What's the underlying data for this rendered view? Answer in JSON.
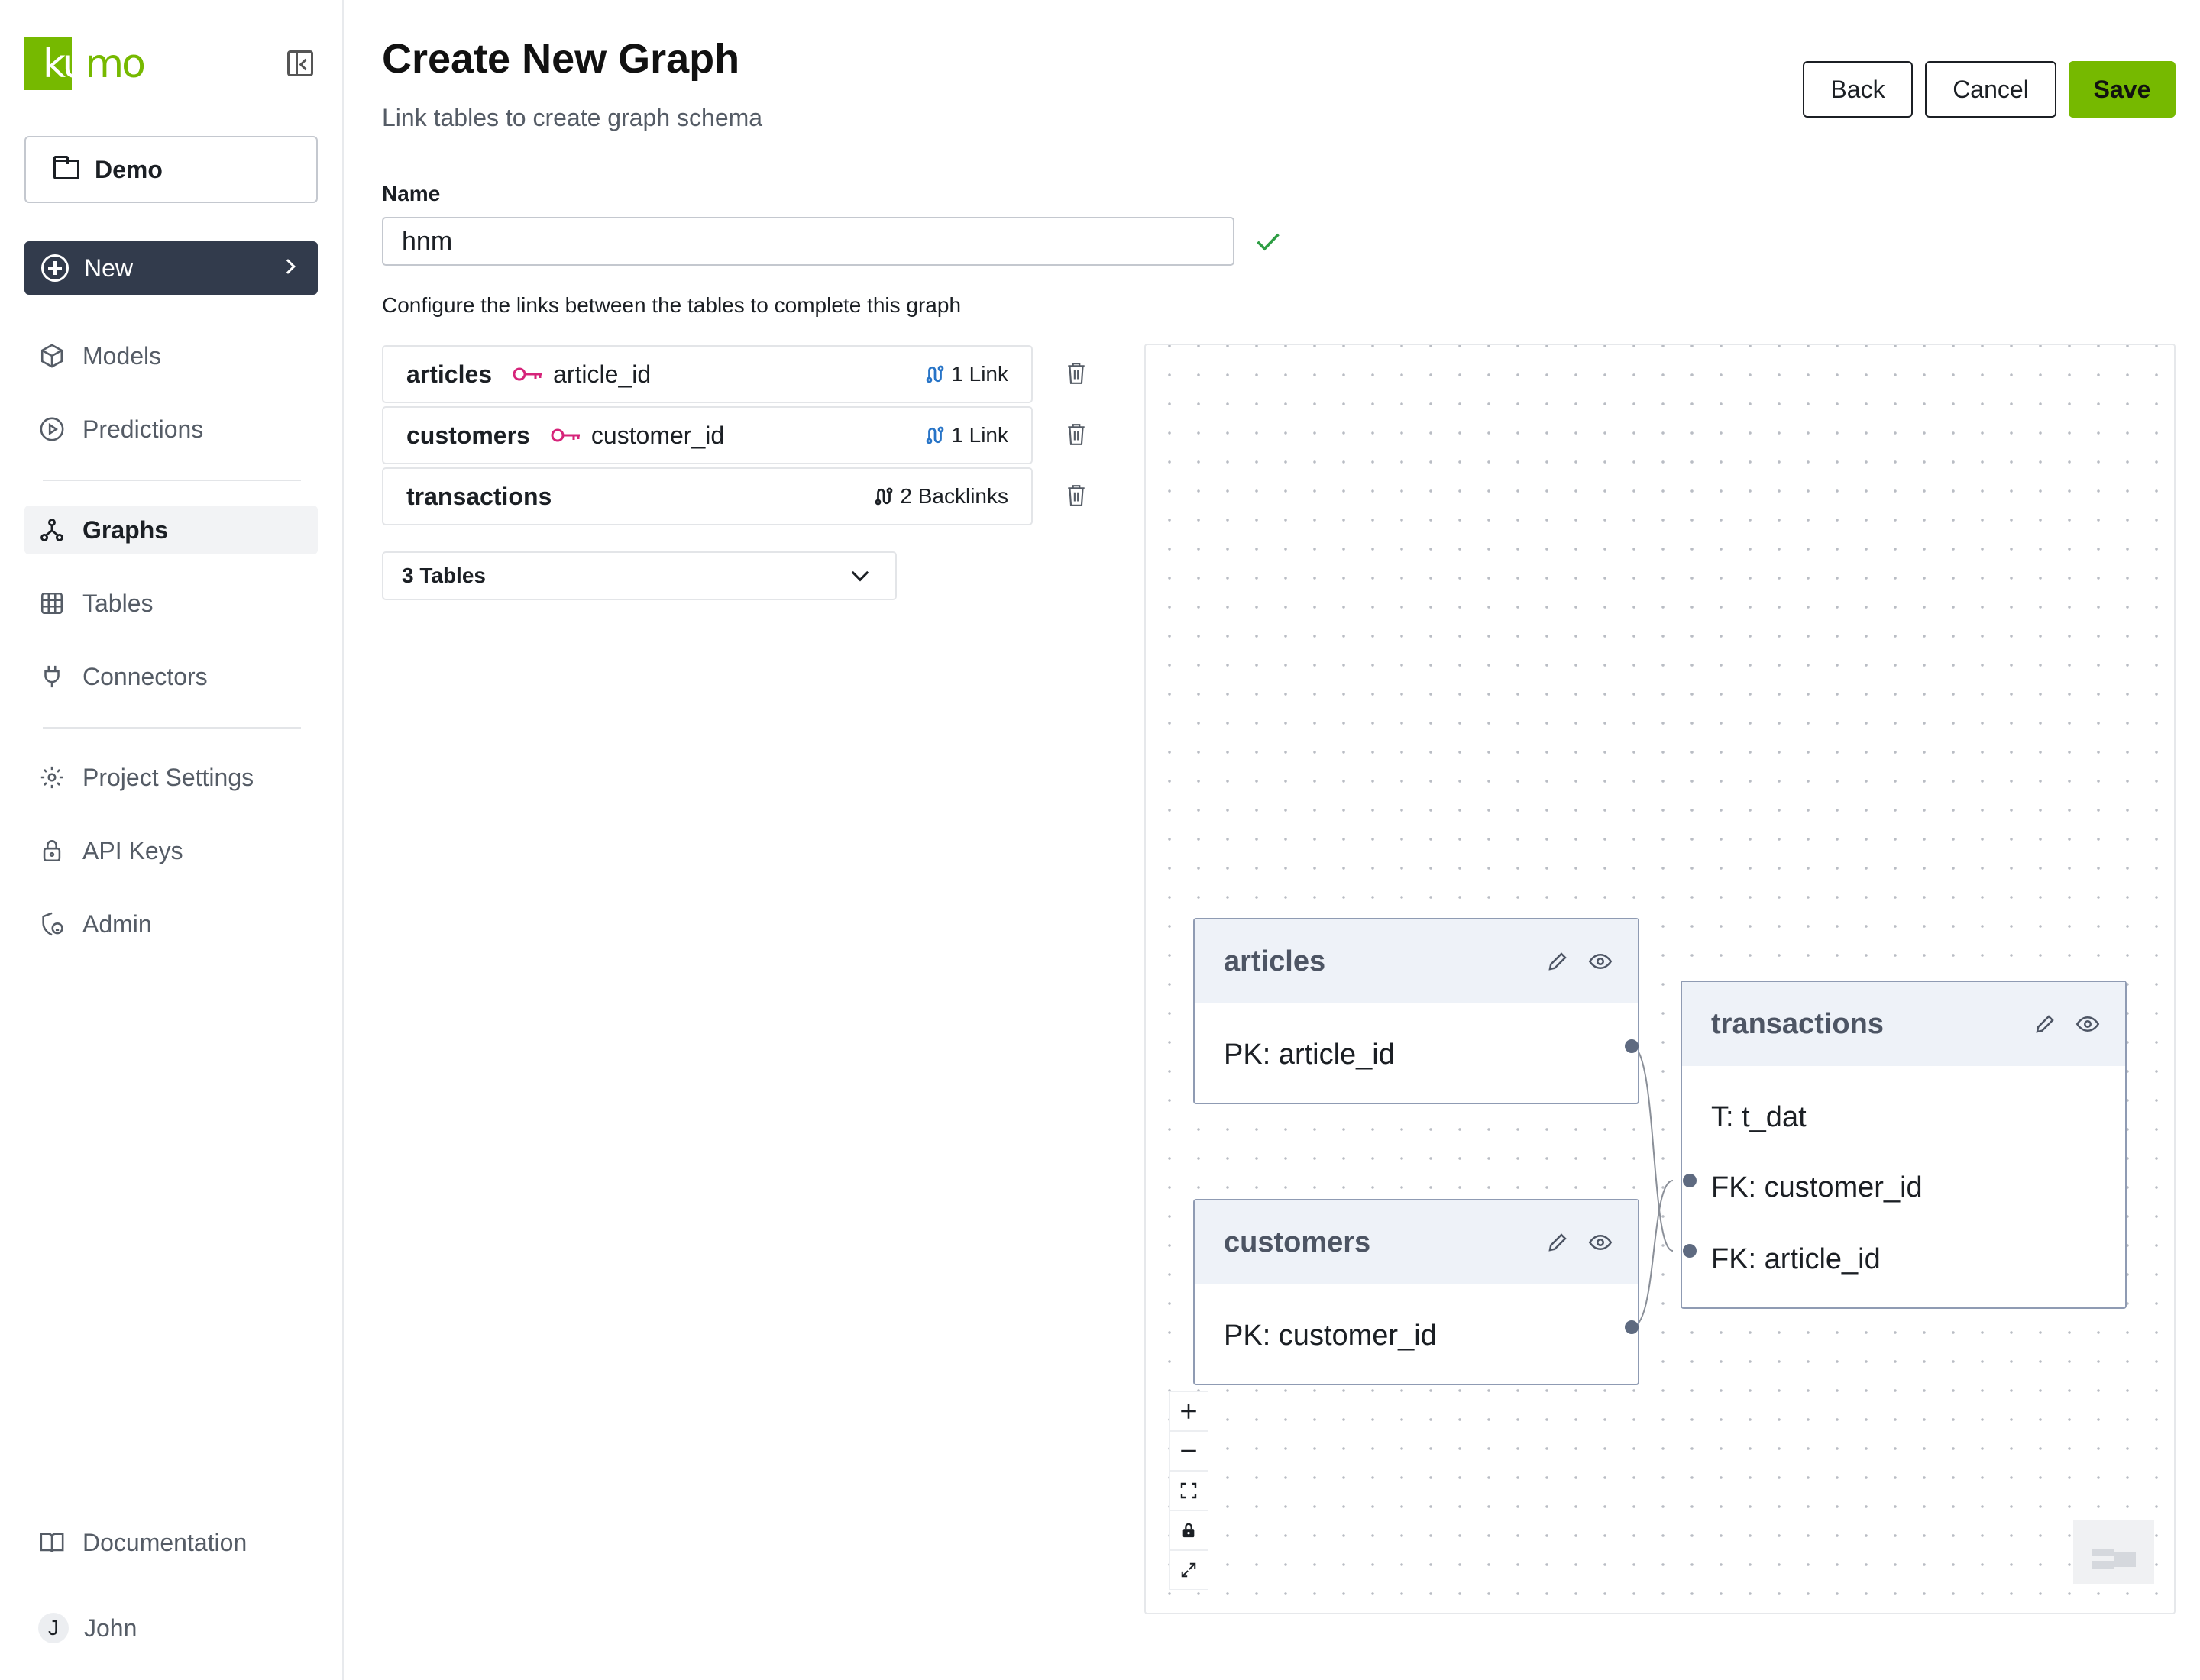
{
  "brand": {
    "logo_text": "kumo",
    "accent": "#76b900"
  },
  "sidebar": {
    "project": "Demo",
    "new_label": "New",
    "items": [
      {
        "label": "Models",
        "icon": "cube-icon"
      },
      {
        "label": "Predictions",
        "icon": "play-circle-icon"
      },
      {
        "label": "Graphs",
        "icon": "graph-icon",
        "active": true
      },
      {
        "label": "Tables",
        "icon": "table-grid-icon"
      },
      {
        "label": "Connectors",
        "icon": "plug-icon"
      },
      {
        "label": "Project Settings",
        "icon": "gear-icon"
      },
      {
        "label": "API Keys",
        "icon": "lock-icon"
      },
      {
        "label": "Admin",
        "icon": "shield-user-icon"
      }
    ],
    "documentation": "Documentation",
    "user": {
      "initial": "J",
      "name": "John"
    }
  },
  "header": {
    "title": "Create New Graph",
    "subtitle": "Link tables to create graph schema",
    "back": "Back",
    "cancel": "Cancel",
    "save": "Save"
  },
  "form": {
    "name_label": "Name",
    "name_value": "hnm",
    "config_text": "Configure the links between the tables to complete this graph"
  },
  "table_rows": [
    {
      "name": "articles",
      "key": "article_id",
      "links": "1 Link"
    },
    {
      "name": "customers",
      "key": "customer_id",
      "links": "1 Link"
    },
    {
      "name": "transactions",
      "key": "",
      "links": "2 Backlinks"
    }
  ],
  "tables_select": "3 Tables",
  "graph": {
    "nodes": [
      {
        "title": "articles",
        "fields": [
          "PK: article_id"
        ]
      },
      {
        "title": "customers",
        "fields": [
          "PK: customer_id"
        ]
      },
      {
        "title": "transactions",
        "fields": [
          "T: t_dat",
          "FK: customer_id",
          "FK: article_id"
        ]
      }
    ],
    "controls": [
      "zoom-in-icon",
      "zoom-out-icon",
      "fit-view-icon",
      "lock-icon",
      "expand-icon"
    ]
  }
}
